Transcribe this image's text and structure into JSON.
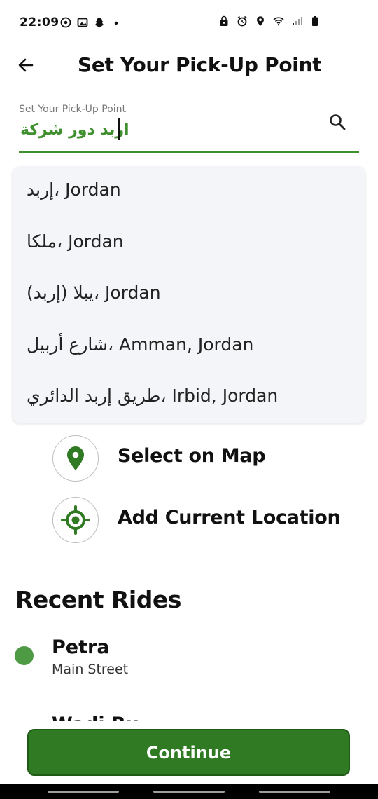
{
  "status_bar": {
    "time": "22:09",
    "left_icons": [
      "whatsapp-icon",
      "gallery-icon",
      "snapchat-icon",
      "dot-icon"
    ],
    "right_icons": [
      "lock-icon",
      "alarm-icon",
      "location-icon",
      "wifi-icon",
      "signal-icon",
      "battery-icon"
    ]
  },
  "header": {
    "title": "Set Your Pick-Up Point"
  },
  "search": {
    "label": "Set Your Pick-Up Point",
    "value": "اربد دور شركة"
  },
  "suggestions": [
    "إربد، Jordan",
    "ملكا، Jordan",
    "يبلا (إربد)، Jordan",
    "شارع أربيل، Amman, Jordan",
    "طريق إربد الدائري، Irbid, Jordan"
  ],
  "actions": {
    "select_on_map": "Select on Map",
    "add_current_location": "Add Current Location"
  },
  "recent": {
    "title": "Recent Rides",
    "rides": [
      {
        "name": "Petra",
        "subtitle": "Main Street"
      }
    ],
    "partial_next": "Wadi Ru"
  },
  "footer": {
    "continue_label": "Continue"
  },
  "colors": {
    "accent_green": "#3f8f2e",
    "button_green": "#2f7a22",
    "dot_green": "#4f9a45"
  }
}
